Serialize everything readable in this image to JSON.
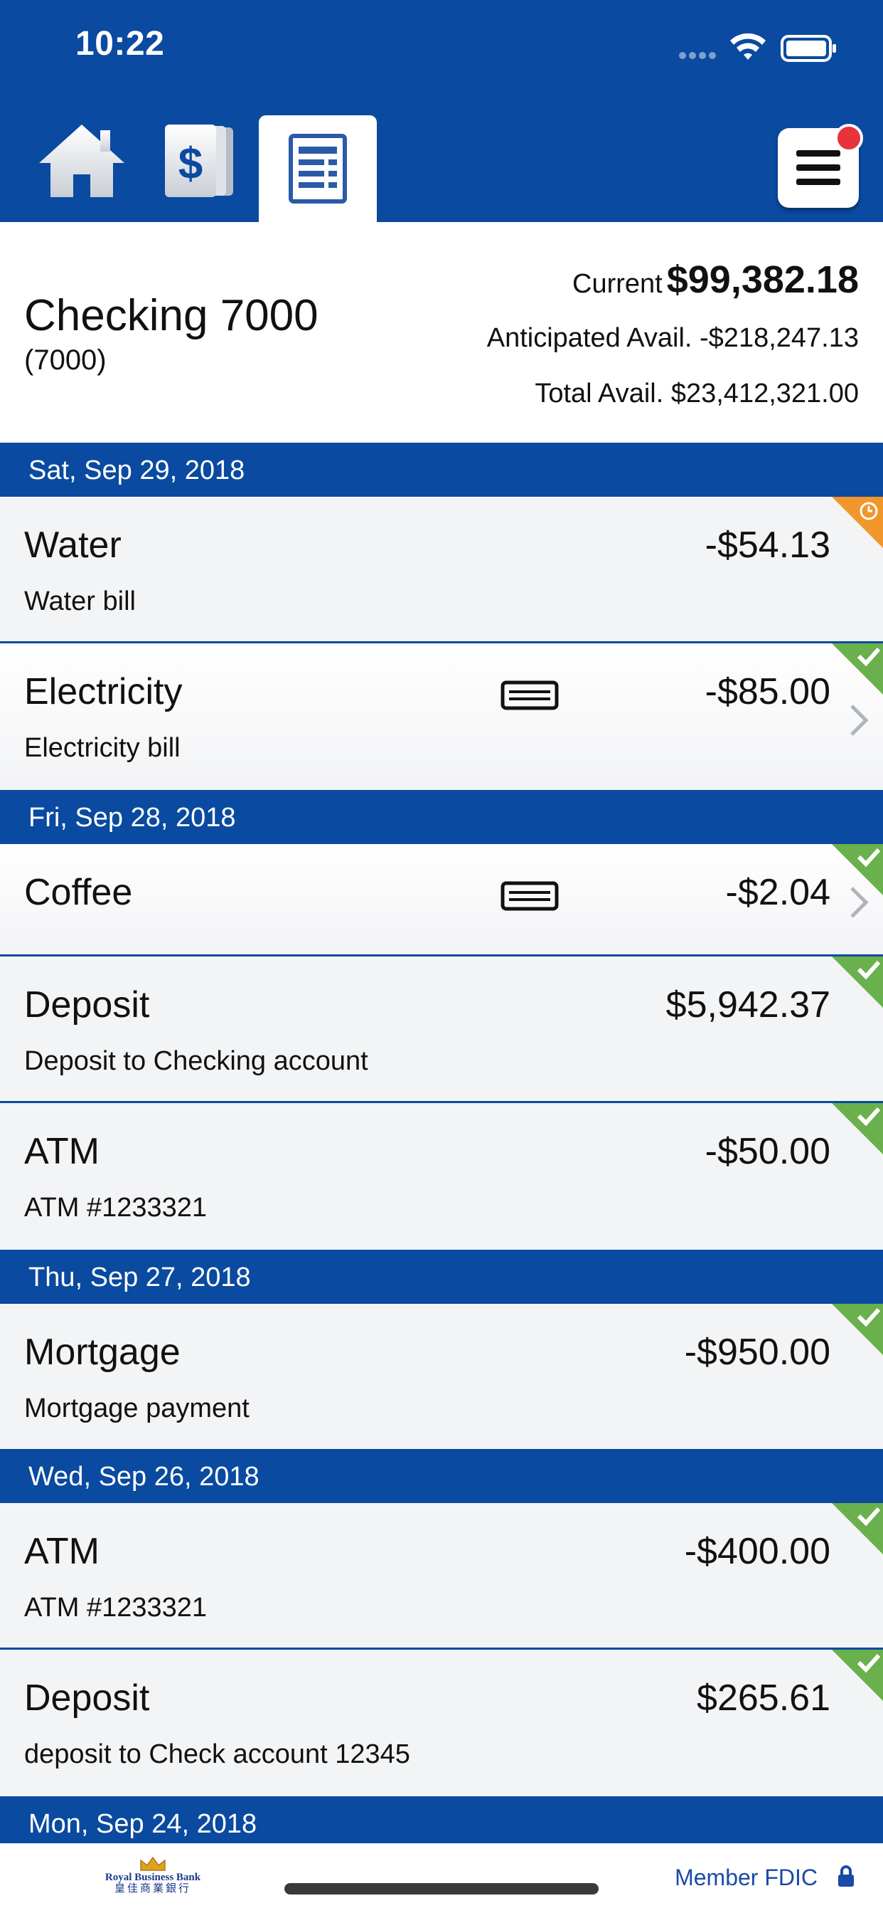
{
  "status_bar": {
    "time": "10:22"
  },
  "nav": {
    "tabs": [
      {
        "name": "home",
        "icon": "home-icon"
      },
      {
        "name": "accounts",
        "icon": "dollar-cards-icon"
      },
      {
        "name": "register",
        "icon": "register-icon",
        "active": true
      }
    ],
    "menu_icon": "hamburger-menu-icon",
    "has_notification": true
  },
  "account": {
    "name": "Checking 7000",
    "number": "(7000)",
    "current_label": "Current",
    "current_amount": "$99,382.18",
    "anticipated": "Anticipated Avail. -$218,247.13",
    "total": "Total Avail. $23,412,321.00"
  },
  "groups": [
    {
      "date": "Sat, Sep 29, 2018",
      "transactions": [
        {
          "title": "Water",
          "desc": "Water bill",
          "amount": "-$54.13",
          "status": "pending"
        },
        {
          "title": "Electricity",
          "desc": "Electricity bill",
          "amount": "-$85.00",
          "status": "cleared",
          "card": true,
          "chevron": true
        }
      ]
    },
    {
      "date": "Fri, Sep 28, 2018",
      "transactions": [
        {
          "title": "Coffee",
          "desc": "",
          "amount": "-$2.04",
          "status": "cleared",
          "card": true,
          "chevron": true
        },
        {
          "title": "Deposit",
          "desc": "Deposit to Checking account",
          "amount": "$5,942.37",
          "status": "cleared"
        },
        {
          "title": "ATM",
          "desc": "ATM #1233321",
          "amount": "-$50.00",
          "status": "cleared"
        }
      ]
    },
    {
      "date": "Thu, Sep 27, 2018",
      "transactions": [
        {
          "title": "Mortgage",
          "desc": "Mortgage payment",
          "amount": "-$950.00",
          "status": "cleared"
        }
      ]
    },
    {
      "date": "Wed, Sep 26, 2018",
      "transactions": [
        {
          "title": "ATM",
          "desc": "ATM #1233321",
          "amount": "-$400.00",
          "status": "cleared"
        },
        {
          "title": "Deposit",
          "desc": "deposit to Check account 12345",
          "amount": "$265.61",
          "status": "cleared"
        }
      ]
    },
    {
      "date": "Mon, Sep 24, 2018",
      "transactions": []
    }
  ],
  "footer": {
    "bank_name": "Royal Business Bank",
    "bank_name_cn": "皇佳商業銀行",
    "fdic": "Member FDIC"
  },
  "colors": {
    "brand_blue": "#0a4aa0",
    "pending_orange": "#f0962a",
    "cleared_green": "#6ab04c",
    "badge_red": "#e8323c"
  }
}
